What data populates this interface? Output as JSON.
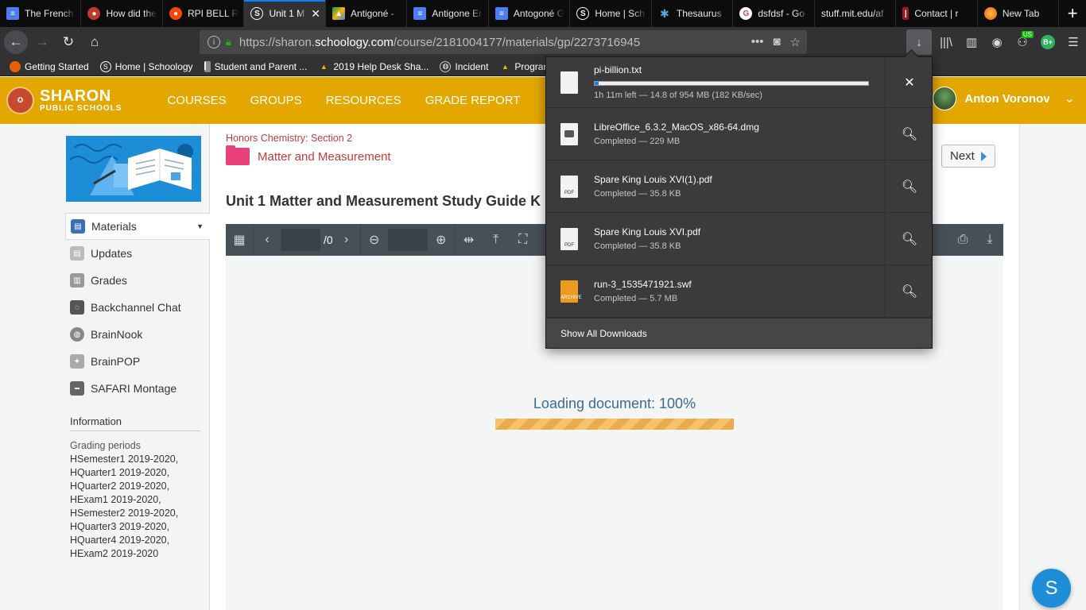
{
  "browser": {
    "tabs": [
      {
        "label": "The French",
        "icon": "docs-icon",
        "color": "#4a7ef2"
      },
      {
        "label": "How did the",
        "icon": "site-icon",
        "color": "#c0392b"
      },
      {
        "label": "RPI BELL RI",
        "icon": "reddit-icon",
        "color": "#ff4500"
      },
      {
        "label": "Unit 1 M",
        "icon": "schoology-icon",
        "color": "#1e8dd8",
        "active": true
      },
      {
        "label": "Antigoné - ",
        "icon": "drive-icon",
        "color": "#f4b400"
      },
      {
        "label": "Antigone Er",
        "icon": "docs-icon",
        "color": "#4a7ef2"
      },
      {
        "label": "Antogoné G",
        "icon": "docs-icon",
        "color": "#4a7ef2"
      },
      {
        "label": "Home | Sch",
        "icon": "schoology-icon",
        "color": "#1e8dd8"
      },
      {
        "label": "Thesaurus",
        "icon": "thesaurus-icon",
        "color": "#2b7bc0"
      },
      {
        "label": "dsfdsf - Go",
        "icon": "google-icon",
        "color": "#db4437"
      },
      {
        "label": "stuff.mit.edu/af",
        "icon": "",
        "color": ""
      },
      {
        "label": "Contact | r",
        "icon": "site-icon",
        "color": "#9b1b1b"
      },
      {
        "label": "New Tab",
        "icon": "firefox-icon",
        "color": "#e66000"
      }
    ],
    "url_prefix": "https://sharon.",
    "url_domain": "schoology.com",
    "url_path": "/course/2181004177/materials/gp/2273716945",
    "toolbar_badge": "US",
    "profile_badge": "B+",
    "bookmarks": [
      {
        "label": "Getting Started",
        "color": "#e66000"
      },
      {
        "label": "Home | Schoology",
        "color": "#1e8dd8"
      },
      {
        "label": "Student and Parent ...",
        "color": "#8a8a8a"
      },
      {
        "label": "2019 Help Desk Sha...",
        "color": "#f4b400"
      },
      {
        "label": "Incident",
        "color": "#777777"
      },
      {
        "label": "Programi",
        "color": "#f4b400"
      }
    ]
  },
  "header": {
    "logo_line1": "SHARON",
    "logo_line2": "PUBLIC SCHOOLS",
    "nav": [
      "COURSES",
      "GROUPS",
      "RESOURCES",
      "GRADE REPORT"
    ],
    "user_name": "Anton Voronov"
  },
  "sidebar": {
    "items": [
      {
        "label": "Materials",
        "active": true,
        "color": "#3a6fb5"
      },
      {
        "label": "Updates",
        "color": "#bbbbbb"
      },
      {
        "label": "Grades",
        "color": "#999999"
      },
      {
        "label": "Backchannel Chat",
        "color": "#555555"
      },
      {
        "label": "BrainNook",
        "color": "#888888"
      },
      {
        "label": "BrainPOP",
        "color": "#aaaaaa"
      },
      {
        "label": "SAFARI Montage",
        "color": "#666666"
      }
    ],
    "info_heading": "Information",
    "grading_title": "Grading periods",
    "grading_periods": [
      "HSemester1 2019-2020,",
      "HQuarter1 2019-2020,",
      "HQuarter2 2019-2020,",
      "HExam1 2019-2020,",
      "HSemester2 2019-2020,",
      "HQuarter3 2019-2020,",
      "HQuarter4 2019-2020,",
      "HExam2 2019-2020"
    ]
  },
  "content": {
    "breadcrumb": "Honors Chemistry: Section 2",
    "folder_title": "Matter and Measurement",
    "next_label": "Next",
    "doc_title": "Unit 1 Matter and Measurement Study Guide K",
    "page_total": "/0",
    "loading_text": "Loading document: 100%"
  },
  "downloads": {
    "items": [
      {
        "name": "pi-billion.txt",
        "status": "1h 11m left — 14.8 of 954 MB (182 KB/sec)",
        "progress": 0.0155,
        "in_progress": true,
        "type": "txt",
        "action": "cancel"
      },
      {
        "name": "LibreOffice_6.3.2_MacOS_x86-64.dmg",
        "status": "Completed — 229 MB",
        "type": "dmg",
        "action": "open-folder"
      },
      {
        "name": "Spare King Louis XVI(1).pdf",
        "status": "Completed — 35.8 KB",
        "type": "pdf",
        "action": "open-folder"
      },
      {
        "name": "Spare King Louis XVI.pdf",
        "status": "Completed — 35.8 KB",
        "type": "pdf",
        "action": "open-folder"
      },
      {
        "name": "run-3_1535471921.swf",
        "status": "Completed — 5.7 MB",
        "type": "archive",
        "action": "open-folder"
      }
    ],
    "show_all": "Show All Downloads"
  },
  "chat_label": "S"
}
